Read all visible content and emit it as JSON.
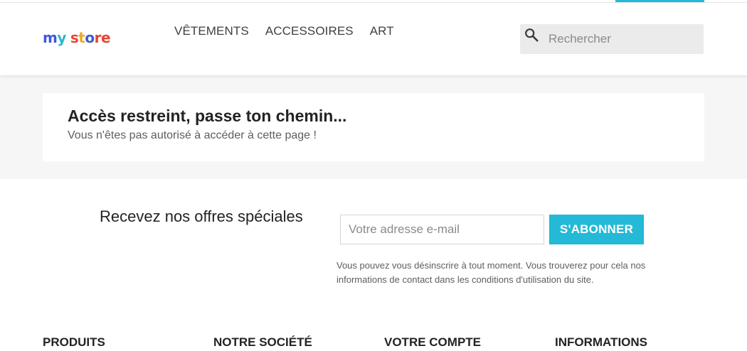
{
  "header": {
    "logo": {
      "letters": [
        "m",
        "y",
        " ",
        "s",
        "t",
        "o",
        "r",
        "e"
      ],
      "colors": [
        "#3b5ad7",
        "#2bb7cc",
        "#ffffff",
        "#e3452f",
        "#f2a823",
        "#3b5ad7",
        "#e3452f",
        "#e3452f"
      ]
    },
    "nav": [
      {
        "label": "VÊTEMENTS"
      },
      {
        "label": "ACCESSOIRES"
      },
      {
        "label": "ART"
      }
    ],
    "search": {
      "placeholder": "Rechercher",
      "icon": "search-icon"
    }
  },
  "main": {
    "title": "Accès restreint, passe ton chemin...",
    "message": "Vous n'êtes pas autorisé à accéder à cette page !"
  },
  "newsletter": {
    "title": "Recevez nos offres spéciales",
    "email_placeholder": "Votre adresse e-mail",
    "button_label": "S'ABONNER",
    "note": "Vous pouvez vous désinscrire à tout moment. Vous trouverez pour cela nos informations de contact dans les conditions d'utilisation du site."
  },
  "footer": {
    "headings": [
      "PRODUITS",
      "NOTRE SOCIÉTÉ",
      "VOTRE COMPTE",
      "INFORMATIONS"
    ]
  },
  "colors": {
    "accent": "#24b9d7",
    "background_grey": "#f6f6f6"
  }
}
